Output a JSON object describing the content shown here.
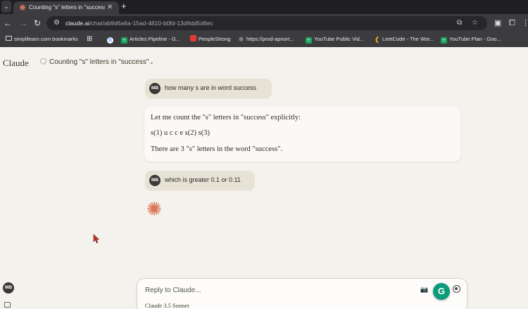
{
  "browser": {
    "tab": {
      "title": "Counting \"s\" letters in \"success",
      "close": "✕"
    },
    "new_tab": "+",
    "url": {
      "host": "claude.ai",
      "path": "/chat/ab9d6a6a-15ad-4810-b0fd-13d9dd5d6ec"
    },
    "bookmarks": [
      {
        "label": "simplilearn.com bookmarks",
        "icon": "folder-icon"
      },
      {
        "label": "",
        "icon": "apps-grid-icon"
      },
      {
        "label": "",
        "icon": "google-icon"
      },
      {
        "label": "Articles Pipeline - G...",
        "icon": "sheets-icon"
      },
      {
        "label": "PeopleStrong",
        "icon": "peoplestrong-icon"
      },
      {
        "label": "https://prod-apnort...",
        "icon": "gear-icon"
      },
      {
        "label": "YouTube Public Vid...",
        "icon": "sheets-icon"
      },
      {
        "label": "LeetCode - The Wor...",
        "icon": "leetcode-icon"
      },
      {
        "label": "YouTube Plan - Goo...",
        "icon": "sheets-icon"
      }
    ]
  },
  "app": {
    "brand": "Claude",
    "chat_title": "Counting \"s\" letters in \"success\""
  },
  "messages": {
    "user_initials": "MB",
    "user1": "how many s are in word success",
    "assistant1": [
      "Let me count the \"s\" letters in \"success\" explicitly:",
      "s(1) u c c e s(2) s(3)",
      "There are 3 \"s\" letters in the word \"success\"."
    ],
    "user2": "which is greater 0.1 or 0.11"
  },
  "composer": {
    "placeholder": "Reply to Claude...",
    "model": "Claude 3.5 Sonnet",
    "grammarly": "G"
  },
  "colors": {
    "accent": "#d97757",
    "page_bg": "#f4f2ec",
    "user_bubble": "#e6e2d6",
    "avatar": "#3a3935"
  }
}
